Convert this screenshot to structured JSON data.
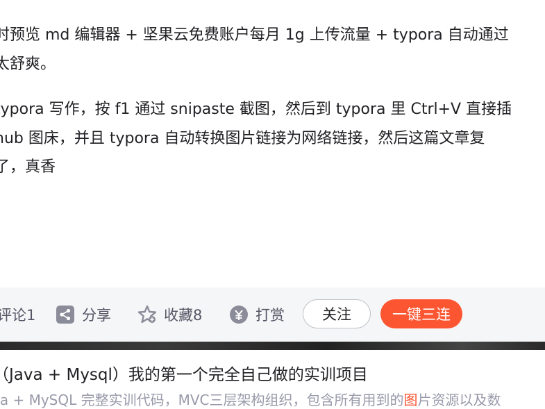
{
  "article": {
    "line1": "时预览 md 编辑器 + 坚果云免费账户每月 1g 上传流量 + typora 自动通过",
    "line2": "太舒爽。",
    "line3": "typora 写作，按 f1 通过 snipaste 截图，然后到 typora 里 Ctrl+V 直接插",
    "line4": "hub 图床，并且 typora 自动转换图片链接为网络链接，然后这篇文章复",
    "line5": "了，真香"
  },
  "toolbar": {
    "comment_label": "评论1",
    "share_label": "分享",
    "collect_label": "收藏8",
    "reward_label": "打赏",
    "follow_label": "关注",
    "triple_label": "一键三连",
    "icons": [
      "share-icon",
      "collect-star-icon",
      "reward-coin-icon"
    ],
    "accent_color": "#fc5531"
  },
  "recommend": {
    "title": "（Java + Mysql）我的第一个完全自己做的实训项目",
    "desc_before": "va + MySQL 完整实训代码，MVC三层架构组织，包含所有用到的",
    "desc_highlight": "图",
    "desc_after": "片资源以及数"
  }
}
